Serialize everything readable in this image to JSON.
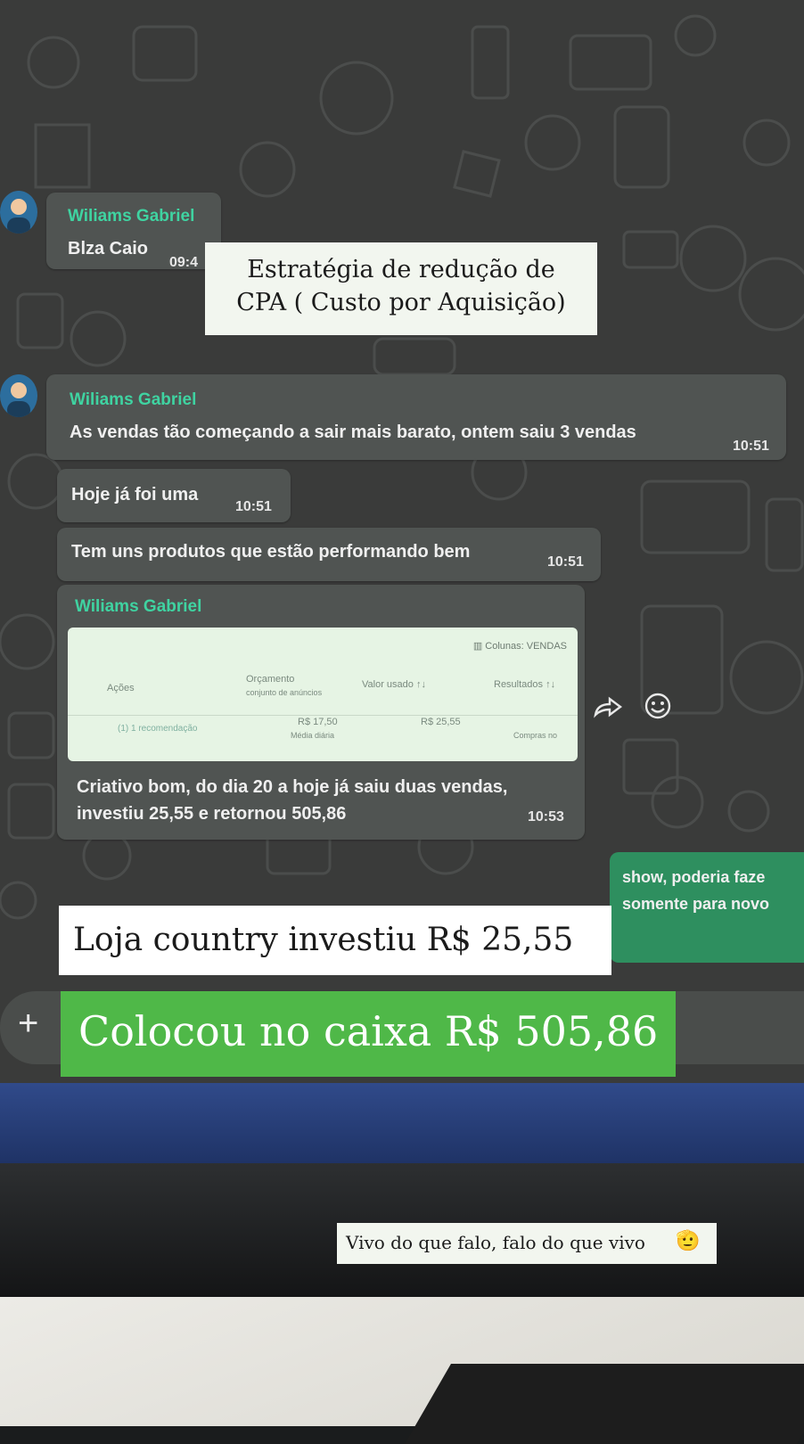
{
  "overlays": {
    "title": "Estratégia de redução de CPA ( Custo por Aquisição)",
    "title_line1": "Estratégia de redução de",
    "title_line2": "CPA ( Custo por Aquisição)",
    "investiu": "Loja country investiu R$ 25,55",
    "caixa": "Colocou no caixa R$ 505,86",
    "footer": "Vivo do que falo, falo do que vivo",
    "footer_emoji": "🫡",
    "colors": {
      "caixa_bg": "#4fb848",
      "label_bg": "#ffffff"
    }
  },
  "chat": {
    "messages": [
      {
        "sender": "Wiliams Gabriel",
        "text": "Blza Caio",
        "time": "09:4"
      },
      {
        "sender": "Wiliams Gabriel",
        "text": "As vendas tão começando a sair mais barato, ontem saiu 3 vendas",
        "time": "10:51"
      },
      {
        "text": "Hoje já foi uma",
        "time": "10:51"
      },
      {
        "text": "Tem uns produtos que estão performando bem",
        "time": "10:51"
      },
      {
        "sender": "Wiliams Gabriel",
        "caption_line1": "Criativo bom, do dia 20 a hoje já saiu duas vendas,",
        "caption_line2": "investiu 25,55 e retornou 505,86",
        "time": "10:53"
      }
    ],
    "outgoing": {
      "line1": "show, poderia faze",
      "line2": "somente para novo"
    },
    "composer_plus": "+",
    "colors": {
      "sender": "#3fd3a1",
      "bubble": "#505452",
      "outgoing": "#2e8f5f"
    }
  },
  "ads_table": {
    "columns_button": "Colunas: VENDAS",
    "headers": {
      "acoes": "Ações",
      "orcamento": "Orçamento",
      "orcamento_sub": "conjunto de anúncios",
      "valor_usado": "Valor usado ↑↓",
      "resultados": "Resultados ↑↓"
    },
    "row": {
      "recomendacao": "(1) 1 recomendação",
      "orcamento": "R$ 17,50",
      "orcamento_sub": "Média diária",
      "valor_usado": "R$ 25,55",
      "resultados_sub": "Compras no"
    }
  }
}
